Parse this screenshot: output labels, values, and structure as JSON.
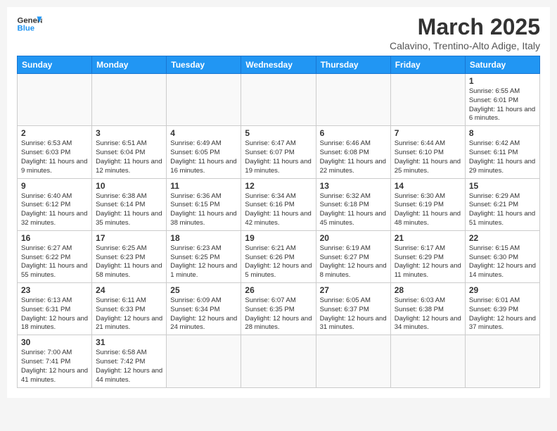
{
  "logo": {
    "text_general": "General",
    "text_blue": "Blue"
  },
  "header": {
    "month": "March 2025",
    "location": "Calavino, Trentino-Alto Adige, Italy"
  },
  "weekdays": [
    "Sunday",
    "Monday",
    "Tuesday",
    "Wednesday",
    "Thursday",
    "Friday",
    "Saturday"
  ],
  "weeks": [
    [
      {
        "day": "",
        "info": ""
      },
      {
        "day": "",
        "info": ""
      },
      {
        "day": "",
        "info": ""
      },
      {
        "day": "",
        "info": ""
      },
      {
        "day": "",
        "info": ""
      },
      {
        "day": "",
        "info": ""
      },
      {
        "day": "1",
        "info": "Sunrise: 6:55 AM\nSunset: 6:01 PM\nDaylight: 11 hours and 6 minutes."
      }
    ],
    [
      {
        "day": "2",
        "info": "Sunrise: 6:53 AM\nSunset: 6:03 PM\nDaylight: 11 hours and 9 minutes."
      },
      {
        "day": "3",
        "info": "Sunrise: 6:51 AM\nSunset: 6:04 PM\nDaylight: 11 hours and 12 minutes."
      },
      {
        "day": "4",
        "info": "Sunrise: 6:49 AM\nSunset: 6:05 PM\nDaylight: 11 hours and 16 minutes."
      },
      {
        "day": "5",
        "info": "Sunrise: 6:47 AM\nSunset: 6:07 PM\nDaylight: 11 hours and 19 minutes."
      },
      {
        "day": "6",
        "info": "Sunrise: 6:46 AM\nSunset: 6:08 PM\nDaylight: 11 hours and 22 minutes."
      },
      {
        "day": "7",
        "info": "Sunrise: 6:44 AM\nSunset: 6:10 PM\nDaylight: 11 hours and 25 minutes."
      },
      {
        "day": "8",
        "info": "Sunrise: 6:42 AM\nSunset: 6:11 PM\nDaylight: 11 hours and 29 minutes."
      }
    ],
    [
      {
        "day": "9",
        "info": "Sunrise: 6:40 AM\nSunset: 6:12 PM\nDaylight: 11 hours and 32 minutes."
      },
      {
        "day": "10",
        "info": "Sunrise: 6:38 AM\nSunset: 6:14 PM\nDaylight: 11 hours and 35 minutes."
      },
      {
        "day": "11",
        "info": "Sunrise: 6:36 AM\nSunset: 6:15 PM\nDaylight: 11 hours and 38 minutes."
      },
      {
        "day": "12",
        "info": "Sunrise: 6:34 AM\nSunset: 6:16 PM\nDaylight: 11 hours and 42 minutes."
      },
      {
        "day": "13",
        "info": "Sunrise: 6:32 AM\nSunset: 6:18 PM\nDaylight: 11 hours and 45 minutes."
      },
      {
        "day": "14",
        "info": "Sunrise: 6:30 AM\nSunset: 6:19 PM\nDaylight: 11 hours and 48 minutes."
      },
      {
        "day": "15",
        "info": "Sunrise: 6:29 AM\nSunset: 6:21 PM\nDaylight: 11 hours and 51 minutes."
      }
    ],
    [
      {
        "day": "16",
        "info": "Sunrise: 6:27 AM\nSunset: 6:22 PM\nDaylight: 11 hours and 55 minutes."
      },
      {
        "day": "17",
        "info": "Sunrise: 6:25 AM\nSunset: 6:23 PM\nDaylight: 11 hours and 58 minutes."
      },
      {
        "day": "18",
        "info": "Sunrise: 6:23 AM\nSunset: 6:25 PM\nDaylight: 12 hours and 1 minute."
      },
      {
        "day": "19",
        "info": "Sunrise: 6:21 AM\nSunset: 6:26 PM\nDaylight: 12 hours and 5 minutes."
      },
      {
        "day": "20",
        "info": "Sunrise: 6:19 AM\nSunset: 6:27 PM\nDaylight: 12 hours and 8 minutes."
      },
      {
        "day": "21",
        "info": "Sunrise: 6:17 AM\nSunset: 6:29 PM\nDaylight: 12 hours and 11 minutes."
      },
      {
        "day": "22",
        "info": "Sunrise: 6:15 AM\nSunset: 6:30 PM\nDaylight: 12 hours and 14 minutes."
      }
    ],
    [
      {
        "day": "23",
        "info": "Sunrise: 6:13 AM\nSunset: 6:31 PM\nDaylight: 12 hours and 18 minutes."
      },
      {
        "day": "24",
        "info": "Sunrise: 6:11 AM\nSunset: 6:33 PM\nDaylight: 12 hours and 21 minutes."
      },
      {
        "day": "25",
        "info": "Sunrise: 6:09 AM\nSunset: 6:34 PM\nDaylight: 12 hours and 24 minutes."
      },
      {
        "day": "26",
        "info": "Sunrise: 6:07 AM\nSunset: 6:35 PM\nDaylight: 12 hours and 28 minutes."
      },
      {
        "day": "27",
        "info": "Sunrise: 6:05 AM\nSunset: 6:37 PM\nDaylight: 12 hours and 31 minutes."
      },
      {
        "day": "28",
        "info": "Sunrise: 6:03 AM\nSunset: 6:38 PM\nDaylight: 12 hours and 34 minutes."
      },
      {
        "day": "29",
        "info": "Sunrise: 6:01 AM\nSunset: 6:39 PM\nDaylight: 12 hours and 37 minutes."
      }
    ],
    [
      {
        "day": "30",
        "info": "Sunrise: 7:00 AM\nSunset: 7:41 PM\nDaylight: 12 hours and 41 minutes."
      },
      {
        "day": "31",
        "info": "Sunrise: 6:58 AM\nSunset: 7:42 PM\nDaylight: 12 hours and 44 minutes."
      },
      {
        "day": "",
        "info": ""
      },
      {
        "day": "",
        "info": ""
      },
      {
        "day": "",
        "info": ""
      },
      {
        "day": "",
        "info": ""
      },
      {
        "day": "",
        "info": ""
      }
    ]
  ]
}
